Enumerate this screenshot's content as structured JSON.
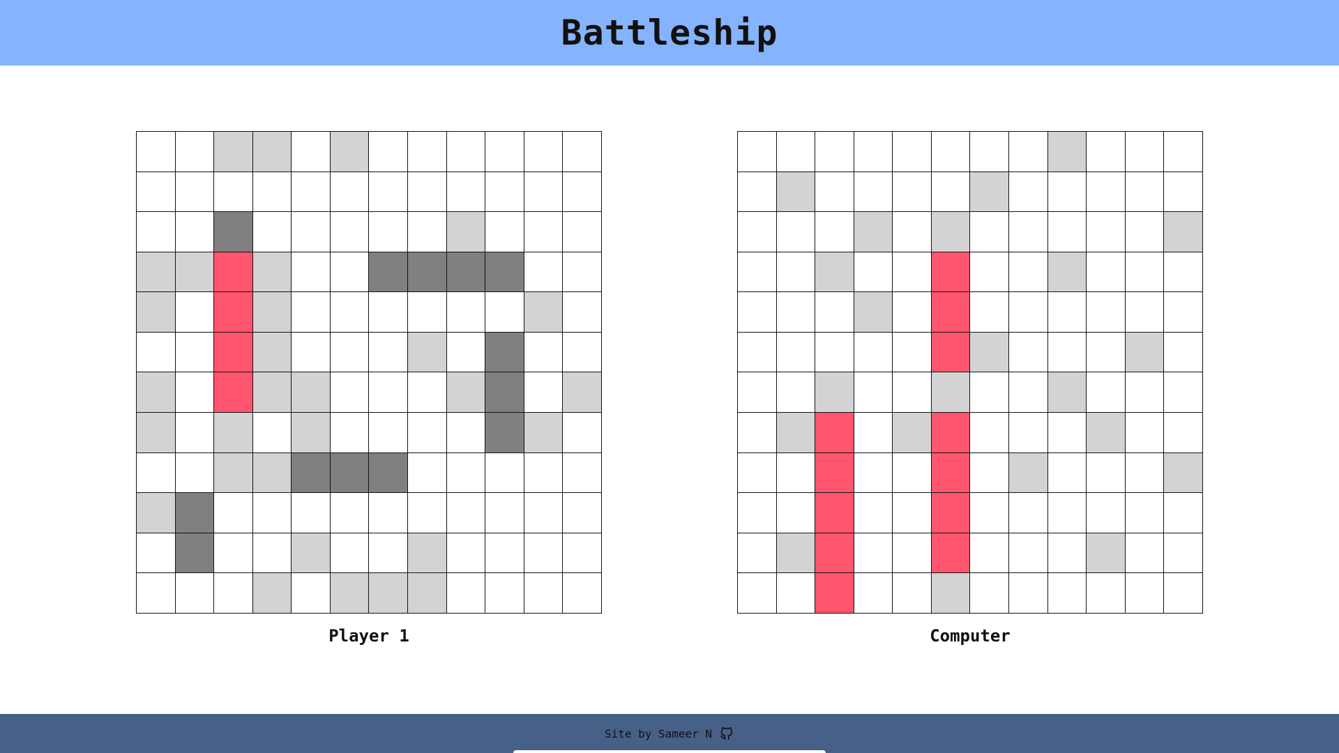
{
  "header": {
    "title": "Battleship"
  },
  "colors": {
    "header_bg": "#86b3fd",
    "footer_bg": "#476088",
    "miss": "#d3d3d3",
    "ship": "#808080",
    "hit": "#ff556e",
    "empty": "#ffffff"
  },
  "cell_legend": {
    ".": "empty",
    "m": "miss",
    "s": "ship",
    "h": "hit"
  },
  "boards": [
    {
      "label": "Player 1",
      "rows": [
        "..mm.m......",
        "............",
        "..s.....m...",
        "mmhm..ssss..",
        "m.hm......m.",
        "..hm...m.s..",
        "m.hmm...ms.m",
        "m.m.m....sm.",
        "..mmsss.....",
        "ms..........",
        ".s..m..m....",
        "...m.mmm...."
      ]
    },
    {
      "label": "Computer",
      "rows": [
        "........m...",
        ".m....m.....",
        "...m.m.....m",
        "..m..h..m...",
        "...m.h......",
        ".....hm...m.",
        "..m..m..m...",
        ".mh.mh...m..",
        "..h..h.m...m",
        "..h..h......",
        ".mh..h...m..",
        "..h..m......"
      ]
    }
  ],
  "footer": {
    "credit": "Site by Sameer N",
    "icon": "github-icon"
  }
}
